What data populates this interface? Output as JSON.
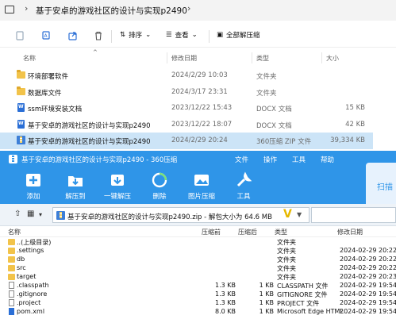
{
  "explorer": {
    "breadcrumb": "基于安卓的游戏社区的设计与实现p2490",
    "toolbar": {
      "sort_label": "排序",
      "view_label": "查看",
      "extract_all_label": "全部解压缩"
    },
    "columns": {
      "name": "名称",
      "date": "修改日期",
      "type": "类型",
      "size": "大小"
    },
    "rows": [
      {
        "icon": "folder-icon",
        "name": "环境部署软件",
        "date": "2024/2/29 10:03",
        "type": "文件夹",
        "size": ""
      },
      {
        "icon": "folder-icon",
        "name": "数据库文件",
        "date": "2024/3/17 23:31",
        "type": "文件夹",
        "size": ""
      },
      {
        "icon": "word-document-icon",
        "name": "ssm环境安装文档",
        "date": "2023/12/22 15:43",
        "type": "DOCX 文档",
        "size": "15 KB"
      },
      {
        "icon": "word-document-icon",
        "name": "基于安卓的游戏社区的设计与实现p2490",
        "date": "2023/12/22 18:07",
        "type": "DOCX 文档",
        "size": "42 KB"
      },
      {
        "icon": "zip-archive-icon",
        "name": "基于安卓的游戏社区的设计与实现p2490",
        "date": "2024/2/29 20:24",
        "type": "360压缩 ZIP 文件",
        "size": "39,334 KB"
      }
    ]
  },
  "zip_window": {
    "title": "基于安卓的游戏社区的设计与实现p2490 - 360压缩",
    "menu": [
      "文件",
      "操作",
      "工具",
      "帮助"
    ],
    "ribbon": [
      {
        "label": "添加",
        "icon": "add-icon"
      },
      {
        "label": "解压到",
        "icon": "extract-to-icon"
      },
      {
        "label": "一键解压",
        "icon": "one-click-extract-icon"
      },
      {
        "label": "删除",
        "icon": "delete-icon"
      },
      {
        "label": "图片压缩",
        "icon": "image-compress-icon"
      },
      {
        "label": "工具",
        "icon": "tools-icon"
      }
    ],
    "scan_label": "扫描",
    "address": "基于安卓的游戏社区的设计与实现p2490.zip - 解包大小为 64.6 MB",
    "columns": {
      "name": "名称",
      "size": "压缩前",
      "csize": "压缩后",
      "type": "类型",
      "date": "修改日期"
    },
    "rows": [
      {
        "icon": "folder-icon",
        "name": "..(上级目录)",
        "size": "",
        "csize": "",
        "type": "文件夹",
        "date": ""
      },
      {
        "icon": "folder-icon",
        "name": ".settings",
        "size": "",
        "csize": "",
        "type": "文件夹",
        "date": "2024-02-29 20:22"
      },
      {
        "icon": "folder-icon",
        "name": "db",
        "size": "",
        "csize": "",
        "type": "文件夹",
        "date": "2024-02-29 20:22"
      },
      {
        "icon": "folder-icon",
        "name": "src",
        "size": "",
        "csize": "",
        "type": "文件夹",
        "date": "2024-02-29 20:22"
      },
      {
        "icon": "folder-icon",
        "name": "target",
        "size": "",
        "csize": "",
        "type": "文件夹",
        "date": "2024-02-29 20:23"
      },
      {
        "icon": "file-icon",
        "name": ".classpath",
        "size": "1.3 KB",
        "csize": "1 KB",
        "type": "CLASSPATH 文件",
        "date": "2024-02-29 19:54"
      },
      {
        "icon": "file-icon",
        "name": ".gitignore",
        "size": "1.3 KB",
        "csize": "1 KB",
        "type": "GITIGNORE 文件",
        "date": "2024-02-29 19:54"
      },
      {
        "icon": "file-icon",
        "name": ".project",
        "size": "1.3 KB",
        "csize": "1 KB",
        "type": "PROJECT 文件",
        "date": "2024-02-29 19:54"
      },
      {
        "icon": "edge-document-icon",
        "name": "pom.xml",
        "size": "8.0 KB",
        "csize": "1 KB",
        "type": "Microsoft Edge HTML",
        "date": "2024-02-29 19:54"
      }
    ]
  },
  "colors": {
    "zip_blue": "#2f95e8",
    "selection": "#cce4f7",
    "folder": "#f2c34a"
  }
}
